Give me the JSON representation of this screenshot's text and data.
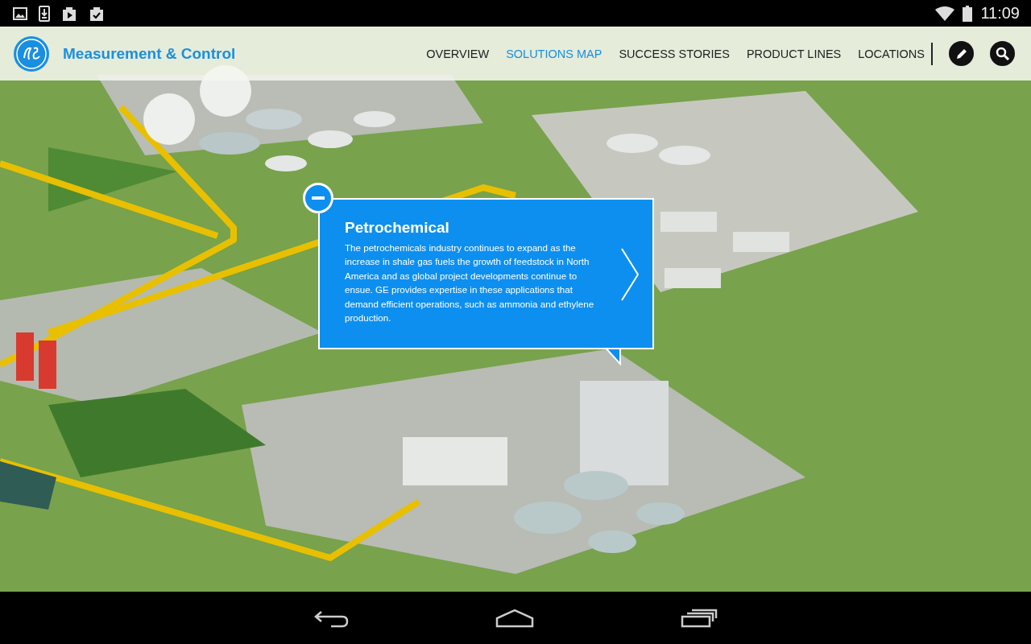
{
  "status_bar": {
    "time": "11:09"
  },
  "header": {
    "brand": "Measurement & Control",
    "nav": [
      {
        "label": "OVERVIEW",
        "selected": false
      },
      {
        "label": "SOLUTIONS MAP",
        "selected": true
      },
      {
        "label": "SUCCESS STORIES",
        "selected": false
      },
      {
        "label": "PRODUCT LINES",
        "selected": false
      },
      {
        "label": "LOCATIONS",
        "selected": false
      }
    ]
  },
  "callout": {
    "title": "Petrochemical",
    "body": "The petrochemicals industry continues to expand as the increase in shale gas fuels the growth of feedstock in North America and as global project developments continue to ensue. GE provides expertise in these applications that demand efficient operations, such as ammonia and ethylene production."
  }
}
